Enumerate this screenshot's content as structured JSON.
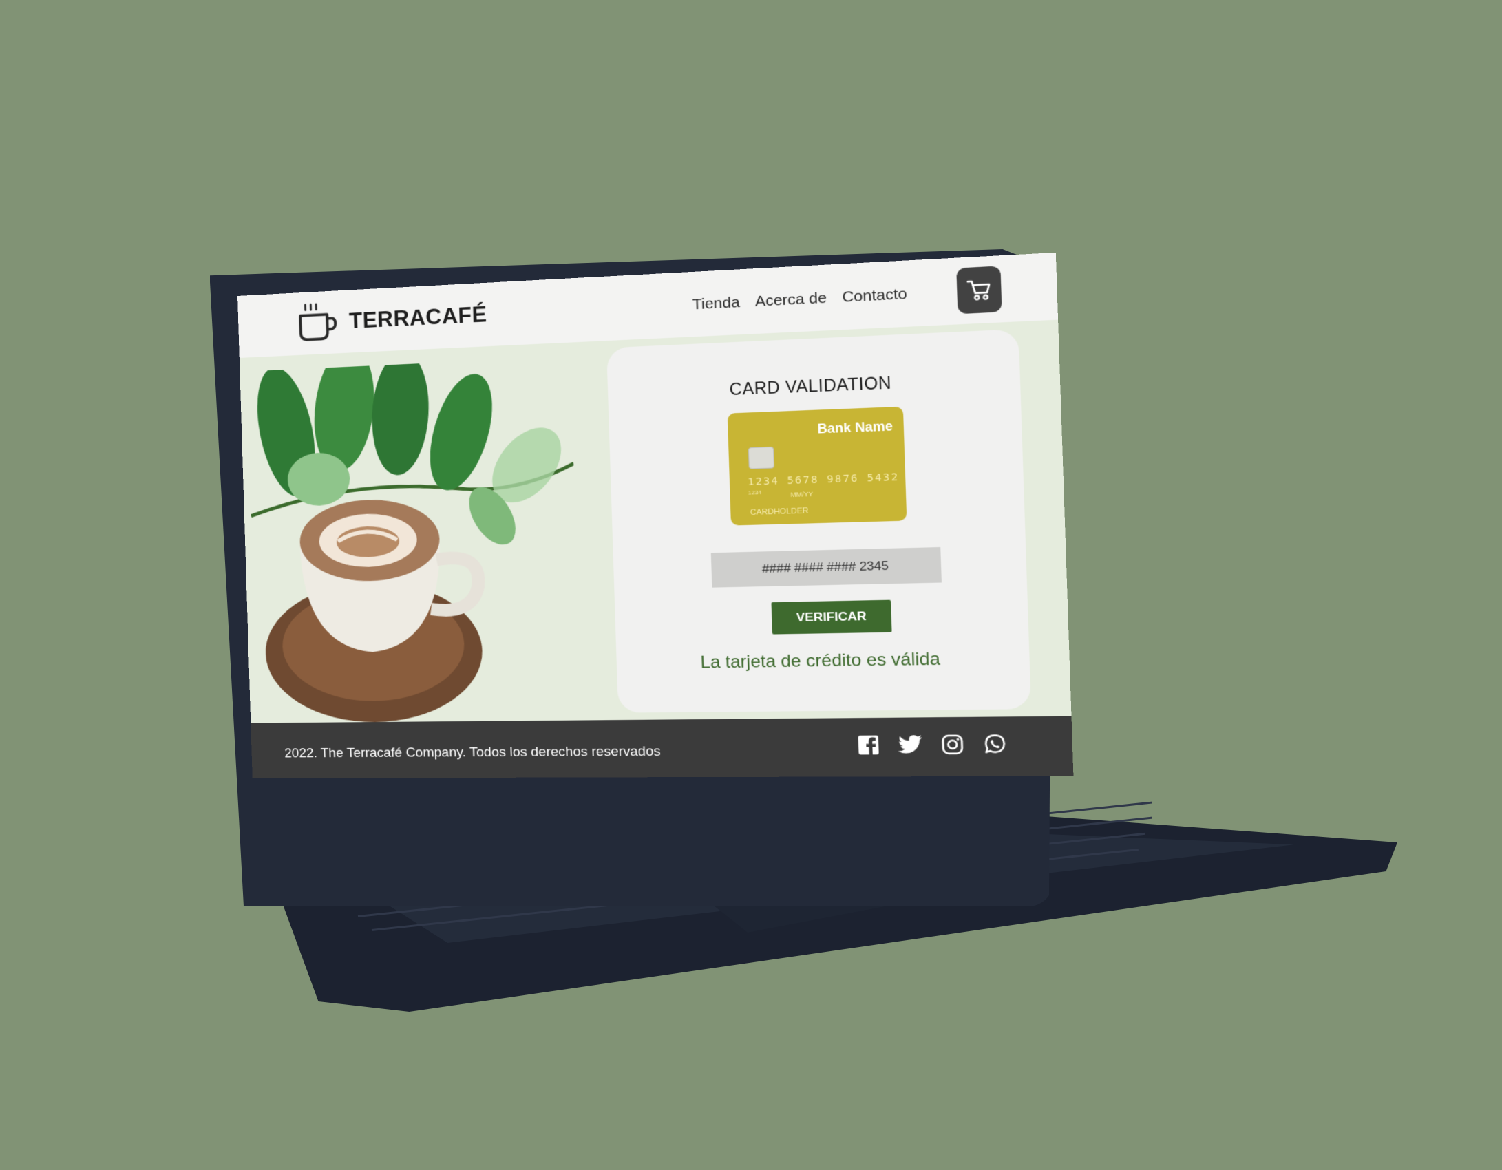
{
  "header": {
    "brand": "TERRACAFÉ",
    "nav": [
      {
        "label": "Tienda"
      },
      {
        "label": "Acerca de"
      },
      {
        "label": "Contacto"
      }
    ],
    "cart_icon": "cart-icon"
  },
  "validation": {
    "title": "CARD VALIDATION",
    "card": {
      "bank_name": "Bank Name",
      "number": "1234 5678 9876 5432",
      "small_number": "1234",
      "expiry": "MM/YY",
      "holder": "CARDHOLDER"
    },
    "input_value": "#### #### #### 2345",
    "button_label": "VERIFICAR",
    "result": "La tarjeta de crédito es válida"
  },
  "footer": {
    "copyright": "2022. The Terracafé Company. Todos los derechos reservados",
    "socials": [
      "facebook-icon",
      "twitter-icon",
      "instagram-icon",
      "whatsapp-icon"
    ]
  },
  "colors": {
    "background": "#819375",
    "accent": "#3e6a2e",
    "card": "#c8b534",
    "footer": "#3b3b3b"
  }
}
